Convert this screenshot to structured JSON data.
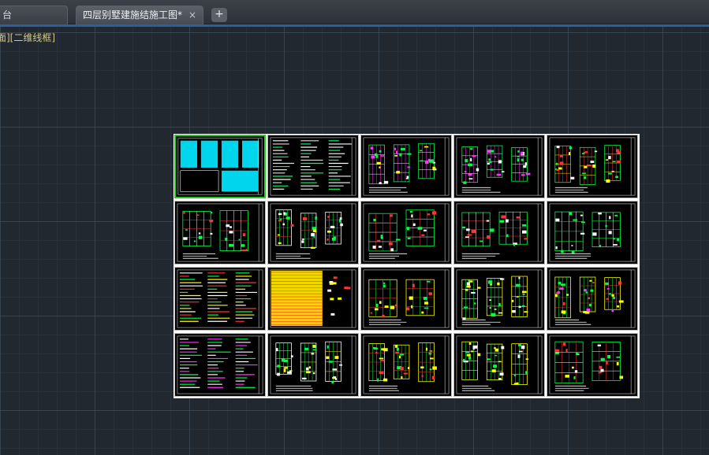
{
  "tabs": {
    "inactive_label": "台",
    "active_label": "四层别墅建施结施工图*",
    "close_icon": "×",
    "add_icon": "+"
  },
  "viewport": {
    "label": "面][二维线框]"
  },
  "sheets": {
    "rows": 4,
    "cols": 5,
    "selected_index": 0
  },
  "colors": {
    "background": "#212830",
    "tab_accent": "#2f5e9c",
    "selection": "#22d11f",
    "label": "#d4c98a"
  }
}
